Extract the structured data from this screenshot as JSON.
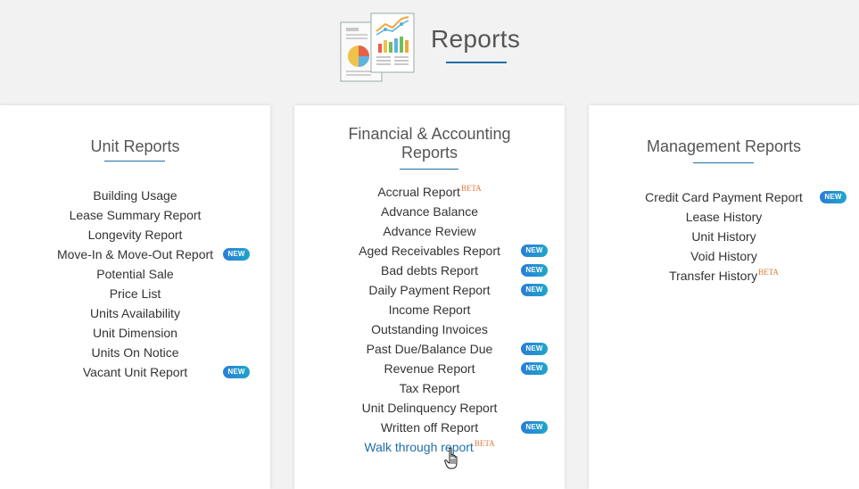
{
  "header": {
    "title": "Reports",
    "icon": "reports-chart-icon"
  },
  "badge_new": "NEW",
  "beta_label": "BETA",
  "colors": {
    "accent": "#1e6fa8",
    "badge": "#2a8ad6",
    "beta": "#e07a3a",
    "background": "#f2f2f2"
  },
  "panels": [
    {
      "title": "Unit Reports",
      "items": [
        {
          "label": "Building Usage"
        },
        {
          "label": "Lease Summary Report"
        },
        {
          "label": "Longevity Report"
        },
        {
          "label": "Move-In & Move-Out Report",
          "new": true
        },
        {
          "label": "Potential Sale"
        },
        {
          "label": "Price List"
        },
        {
          "label": "Units Availability"
        },
        {
          "label": "Unit Dimension"
        },
        {
          "label": "Units On Notice"
        },
        {
          "label": "Vacant Unit Report",
          "new": true
        }
      ]
    },
    {
      "title_line1": "Financial & Accounting",
      "title_line2": "Reports",
      "items": [
        {
          "label": "Accrual Report",
          "beta": true
        },
        {
          "label": "Advance Balance"
        },
        {
          "label": "Advance Review"
        },
        {
          "label": "Aged Receivables Report",
          "new": true
        },
        {
          "label": "Bad debts Report",
          "new": true
        },
        {
          "label": "Daily Payment Report",
          "new": true
        },
        {
          "label": "Income Report"
        },
        {
          "label": "Outstanding Invoices"
        },
        {
          "label": "Past Due/Balance Due",
          "new": true
        },
        {
          "label": "Revenue Report",
          "new": true
        },
        {
          "label": "Tax Report"
        },
        {
          "label": "Unit Delinquency Report"
        },
        {
          "label": "Written off Report",
          "new": true
        },
        {
          "label": "Walk through report",
          "beta": true,
          "hovered": true
        }
      ]
    },
    {
      "title": "Management Reports",
      "items": [
        {
          "label": "Credit Card Payment Report",
          "new": true
        },
        {
          "label": "Lease History"
        },
        {
          "label": "Unit History"
        },
        {
          "label": "Void History"
        },
        {
          "label": "Transfer History",
          "beta": true
        }
      ]
    }
  ]
}
